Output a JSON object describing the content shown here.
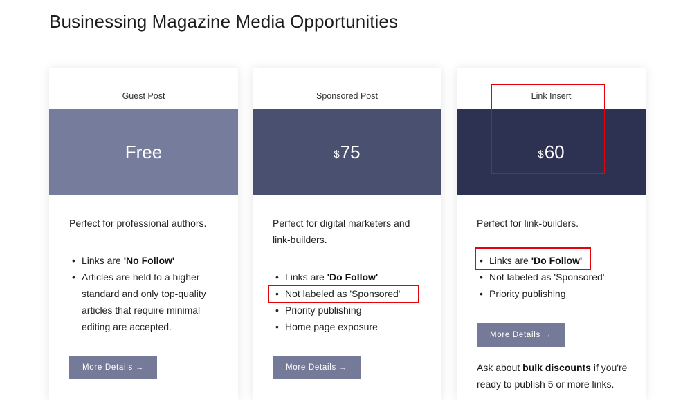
{
  "page": {
    "title": "Businessing Magazine Media Opportunities"
  },
  "colors": {
    "guest_price_bg": "#767c9b",
    "sponsored_price_bg": "#4a506f",
    "link_insert_price_bg": "#2e3252",
    "button_bg": "#747a98",
    "highlight": "#e8000b"
  },
  "cards": [
    {
      "name": "Guest Post",
      "price": "Free",
      "currency": "",
      "description": "Perfect for professional authors.",
      "features": [
        {
          "prefix": "Links are ",
          "bold": "'No Follow'",
          "suffix": ""
        },
        {
          "prefix": "Articles are held to a higher standard and only top-quality articles that require minimal editing are accepted.",
          "bold": "",
          "suffix": ""
        }
      ],
      "button": "More Details →"
    },
    {
      "name": "Sponsored Post",
      "price": "75",
      "currency": "$",
      "description": "Perfect for digital marketers and link-builders.",
      "features": [
        {
          "prefix": "Links are ",
          "bold": "'Do Follow'",
          "suffix": ""
        },
        {
          "prefix": "Not labeled as 'Sponsored'",
          "bold": "",
          "suffix": ""
        },
        {
          "prefix": "Priority publishing",
          "bold": "",
          "suffix": ""
        },
        {
          "prefix": "Home page exposure",
          "bold": "",
          "suffix": ""
        }
      ],
      "button": "More Details →"
    },
    {
      "name": "Link Insert",
      "price": "60",
      "currency": "$",
      "description": "Perfect for link-builders.",
      "features": [
        {
          "prefix": "Links are ",
          "bold": "'Do Follow'",
          "suffix": ""
        },
        {
          "prefix": "Not labeled as 'Sponsored'",
          "bold": "",
          "suffix": ""
        },
        {
          "prefix": "Priority publishing",
          "bold": "",
          "suffix": ""
        }
      ],
      "button": "More Details →",
      "note": {
        "prefix": "Ask about ",
        "bold": "bulk discounts",
        "suffix": " if you're ready to publish 5 or more links."
      }
    }
  ],
  "bullet": "•"
}
